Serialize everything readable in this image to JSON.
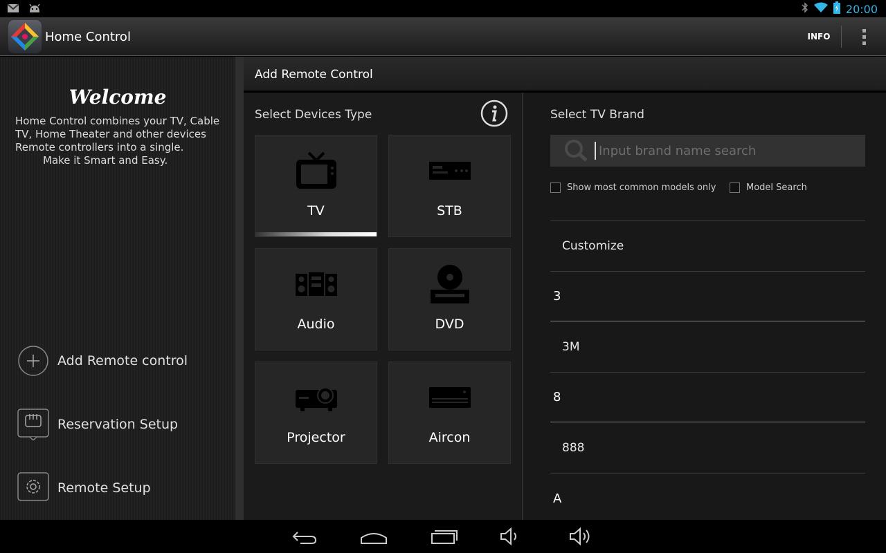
{
  "status_bar": {
    "time": "20:00",
    "icons": [
      "gmail-icon",
      "android-icon",
      "bluetooth-icon",
      "wifi-icon",
      "battery-icon"
    ]
  },
  "action_bar": {
    "title": "Home Control",
    "info_label": "INFO"
  },
  "left_panel": {
    "welcome": "Welcome",
    "description_lines": [
      "Home Control combines your TV, Cable",
      "TV, Home Theater and other devices",
      "Remote controllers into a single.",
      "Make it Smart and Easy."
    ],
    "menu": [
      {
        "label": "Add Remote control",
        "icon": "plus-circle-icon"
      },
      {
        "label": "Reservation Setup",
        "icon": "calendar-icon"
      },
      {
        "label": "Remote Setup",
        "icon": "gear-icon"
      }
    ]
  },
  "main": {
    "header": "Add Remote Control",
    "device_section": {
      "title": "Select Devices Type",
      "devices": [
        {
          "label": "TV",
          "icon": "tv-icon",
          "selected": true
        },
        {
          "label": "STB",
          "icon": "stb-icon",
          "selected": false
        },
        {
          "label": "Audio",
          "icon": "audio-icon",
          "selected": false
        },
        {
          "label": "DVD",
          "icon": "dvd-icon",
          "selected": false
        },
        {
          "label": "Projector",
          "icon": "projector-icon",
          "selected": false
        },
        {
          "label": "Aircon",
          "icon": "aircon-icon",
          "selected": false
        }
      ]
    },
    "brand_section": {
      "title": "Select TV Brand",
      "search_placeholder": "Input brand name search",
      "checkbox_common": "Show most common models only",
      "checkbox_model": "Model Search",
      "brands": [
        {
          "type": "item",
          "label": "Customize"
        },
        {
          "type": "header",
          "label": "3"
        },
        {
          "type": "item",
          "label": "3M"
        },
        {
          "type": "header",
          "label": "8"
        },
        {
          "type": "item",
          "label": "888"
        },
        {
          "type": "header",
          "label": "A"
        }
      ]
    }
  },
  "nav_bar": [
    "back-icon",
    "home-icon",
    "recent-apps-icon",
    "volume-down-icon",
    "volume-up-icon"
  ],
  "colors": {
    "accent": "#33b5e5",
    "background": "#1b1b1b"
  }
}
